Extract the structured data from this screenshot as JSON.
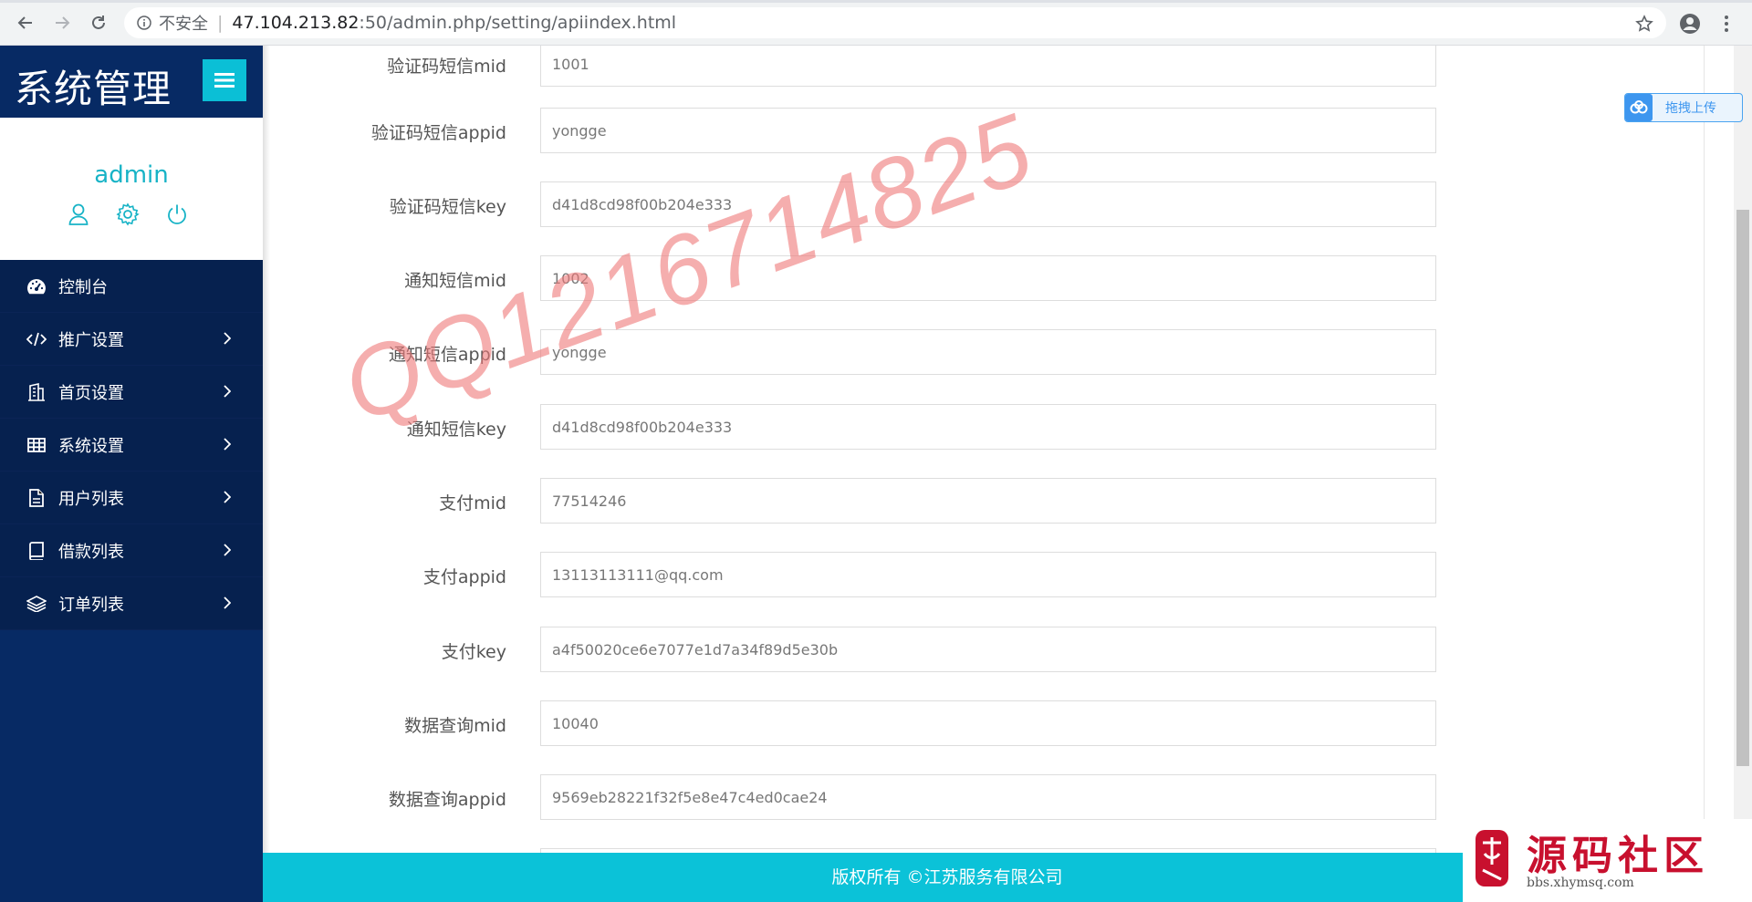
{
  "browser": {
    "insecure_label": "不安全",
    "url_host": "47.104.213.82",
    "url_path": ":50/admin.php/setting/apiindex.html"
  },
  "sidebar": {
    "brand_title": "系统管理",
    "profile_name": "admin",
    "items": [
      {
        "label": "控制台",
        "icon": "dashboard-icon"
      },
      {
        "label": "推广设置",
        "icon": "code-icon"
      },
      {
        "label": "首页设置",
        "icon": "building-icon"
      },
      {
        "label": "系统设置",
        "icon": "grid-icon"
      },
      {
        "label": "用户列表",
        "icon": "file-icon"
      },
      {
        "label": "借款列表",
        "icon": "book-icon"
      },
      {
        "label": "订单列表",
        "icon": "layers-icon"
      }
    ]
  },
  "form": {
    "fields": [
      {
        "label": "验证码短信mid",
        "value": "1001"
      },
      {
        "label": "验证码短信appid",
        "value": "yongge"
      },
      {
        "label": "验证码短信key",
        "value": "d41d8cd98f00b204e333"
      },
      {
        "label": "通知短信mid",
        "value": "1002"
      },
      {
        "label": "通知短信appid",
        "value": "yongge"
      },
      {
        "label": "通知短信key",
        "value": "d41d8cd98f00b204e333"
      },
      {
        "label": "支付mid",
        "value": "77514246"
      },
      {
        "label": "支付appid",
        "value": "13113113111@qq.com"
      },
      {
        "label": "支付key",
        "value": "a4f50020ce6e7077e1d7a34f89d5e30b"
      },
      {
        "label": "数据查询mid",
        "value": "10040"
      },
      {
        "label": "数据查询appid",
        "value": "9569eb28221f32f5e8e47c4ed0cae24"
      }
    ]
  },
  "footer": {
    "text": "版权所有 ©江苏服务有限公司"
  },
  "upload": {
    "label": "拖拽上传"
  },
  "watermark": {
    "text": "QQ1216714825"
  },
  "corner_logo": {
    "title": "源码社区",
    "url": "bbs.xhymsq.com"
  },
  "colors": {
    "sidebar": "#072a64",
    "accent": "#0bc2d8",
    "watermark": "#ee7878"
  }
}
